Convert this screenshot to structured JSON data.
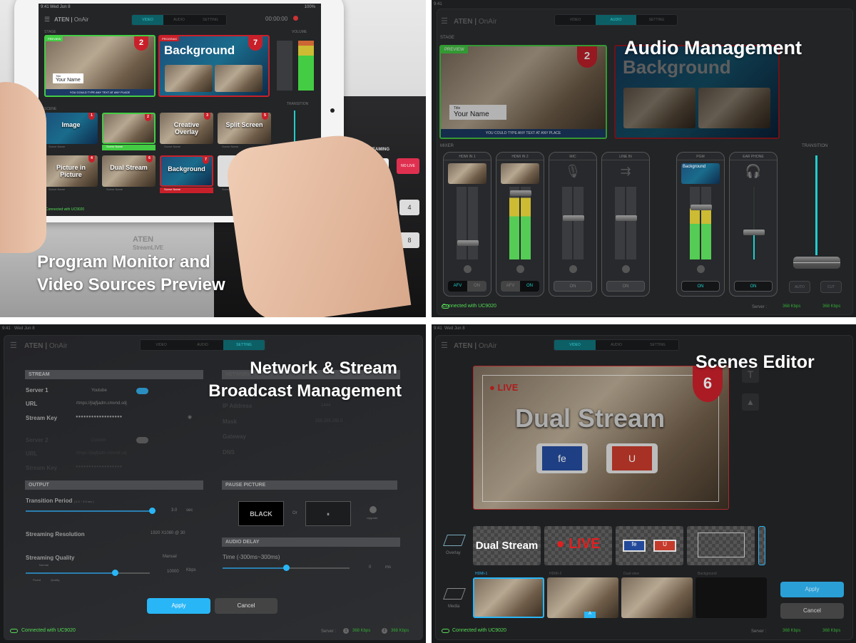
{
  "colors": {
    "accent": "#29b6f6",
    "preview": "#3fbf3f",
    "program": "#c8202a",
    "connected": "#55dd55",
    "teal": "#2fc4c4"
  },
  "app": {
    "brand": "ATEN",
    "product": "OnAir",
    "status_time": "9:41",
    "status_date": "Wed Jun 8",
    "battery": "100%",
    "timer": "00:00:00",
    "tabs": [
      "VIDEO",
      "AUDIO",
      "SETTING"
    ],
    "connected": "Connected with UC9020",
    "server_label": "Server :",
    "server1": "368 Kbps",
    "server2": "368 Kbps",
    "server1_num": "1",
    "server2_num": "2"
  },
  "panel1": {
    "caption_line1": "Program Monitor and",
    "caption_line2": "Video Sources Preview",
    "stage_label": "STAGE",
    "scene_label": "SCENE",
    "volume_label": "VOLUME",
    "transition_label": "TRANSITION",
    "preview_tag": "PREVIEW",
    "program_tag": "PROGRAM",
    "preview_num": "2",
    "program_num": "7",
    "program_title": "Background",
    "lower_third_title": "Title",
    "lower_third_name": "Your Name",
    "ticker": "YOU COULD TYPE ANY TEXT AT ANY PLACE",
    "scenes": [
      {
        "num": "1",
        "title": "Image",
        "name": "Scene Name"
      },
      {
        "num": "2",
        "title": "",
        "name": "Scene Name"
      },
      {
        "num": "3",
        "title": "Creative Overlay",
        "name": "Scene Name"
      },
      {
        "num": "5",
        "title": "Split Screen",
        "name": "Scene Name"
      },
      {
        "num": "4",
        "title": "Picture in Picture",
        "name": "Scene Name"
      },
      {
        "num": "6",
        "title": "Dual Stream",
        "name": "Scene Name"
      },
      {
        "num": "7",
        "title": "Background",
        "name": "Scene Name"
      },
      {
        "num": "8",
        "title": "",
        "name": "Scene Name"
      }
    ],
    "hardware": {
      "brand": "ATEN",
      "model": "StreamLIVE",
      "streaming_label": "STREAMING",
      "no_live": "NO LIVE",
      "keys": [
        "3",
        "4",
        "8"
      ]
    }
  },
  "panel2": {
    "caption": "Audio Management",
    "mixer_label": "MIXER",
    "transition_label": "TRANSITION",
    "channels": [
      {
        "name": "HDMI IN 1",
        "afv": "AFV",
        "on": "ON",
        "level": 0.0,
        "fader": 0.75
      },
      {
        "name": "HDMI IN 2",
        "afv": "AFV",
        "on": "ON",
        "level": 0.85,
        "fader": 0.05
      },
      {
        "name": "MIC",
        "on": "ON",
        "level": 0.0,
        "fader": 0.4
      },
      {
        "name": "LINE IN",
        "on": "ON",
        "level": 0.0,
        "fader": 0.4
      },
      {
        "name": "PGM",
        "on": "ON",
        "level": 0.7,
        "fader": 0.25
      },
      {
        "name": "EAR PHONE",
        "on": "ON",
        "level": 0.0,
        "fader": 0.6
      }
    ],
    "pgm_thumb": "Background",
    "auto": "AUTO",
    "cut": "CUT"
  },
  "panel3": {
    "caption_line1": "Network & Stream",
    "caption_line2": "Broadcast Management",
    "stream_header": "STREAM",
    "network_header": "NETWORK",
    "server1": {
      "label": "Server 1",
      "platform": "Youtube",
      "url_label": "URL",
      "url": "rtmps://jlajfjadm.cmvnd.sdj",
      "key_label": "Stream Key",
      "key": "●●●●●●●●●●●●●●●●●●",
      "enabled": true
    },
    "server2": {
      "label": "Server 2",
      "platform": "Custom",
      "url_label": "URL",
      "url": "rtmps://jlajfjadm.cmvnd.sdj",
      "key_label": "Stream Key",
      "key": "●●●●●●●●●●●●●●●●●●",
      "enabled": false
    },
    "network": {
      "ip_label": "IP Address",
      "ip": "1444",
      "mask_label": "Mask",
      "mask": "255.255.255.0",
      "gateway_label": "Gateway",
      "dns_label": "DNS",
      "dns": "-"
    },
    "output_header": "OUTPUT",
    "transition_label": "Transition Period",
    "transition_range": "( 0.3 ~ 3.0 sec )",
    "transition_value": "3.0",
    "transition_unit": "sec",
    "transition_fraction": 1.0,
    "resolution_label": "Streaming Resolution",
    "resolution": "1920 X1080 @ 30",
    "quality_label": "Streaming Quality",
    "quality_mode": "Manual",
    "quality_value": "10000",
    "quality_unit": "Kbps",
    "quality_fraction": 0.72,
    "quality_marks": [
      "Fluent",
      "Normal",
      "Quality"
    ],
    "pause_header": "PAUSE PICTURE",
    "pause_black": "BLACK",
    "pause_or": "Or",
    "upgrade": "Upgrade",
    "audio_delay_header": "AUDIO DELAY",
    "delay_label": "Time (-300ms~300ms)",
    "delay_value": "0",
    "delay_unit": "ms",
    "delay_fraction": 0.5,
    "apply": "Apply",
    "cancel": "Cancel"
  },
  "panel4": {
    "caption": "Scenes Editor",
    "scene_num": "6",
    "scene_title": "Dual Stream",
    "live": "LIVE",
    "fb": "fe",
    "yt": "U",
    "overlay_label": "Overlay",
    "media_label": "Media",
    "overlays": [
      "Dual Stream",
      "LIVE",
      "",
      ""
    ],
    "media": [
      "HDMI-1",
      "HDMI-2",
      "Dual-view",
      "Background"
    ],
    "media_badge": "A",
    "apply": "Apply",
    "cancel": "Cancel"
  }
}
